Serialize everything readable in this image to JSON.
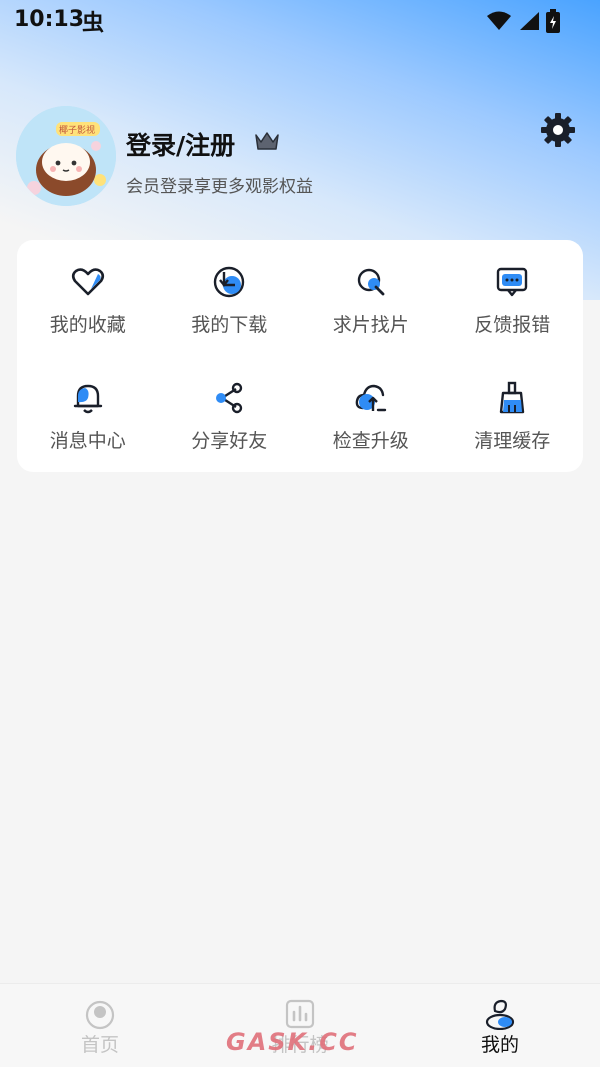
{
  "status_bar": {
    "time": "10:13",
    "bug_glyph": "虫",
    "icons": [
      "wifi-icon",
      "signal-icon",
      "battery-icon"
    ]
  },
  "profile": {
    "title": "登录/注册",
    "subtitle": "会员登录享更多观影权益",
    "avatar_text": "椰子影视",
    "icons": [
      "crown-icon",
      "settings-gear-icon"
    ]
  },
  "menu": {
    "items": [
      {
        "label": "我的收藏",
        "icon": "heart-icon"
      },
      {
        "label": "我的下载",
        "icon": "download-icon"
      },
      {
        "label": "求片找片",
        "icon": "search-film-icon"
      },
      {
        "label": "反馈报错",
        "icon": "feedback-icon"
      },
      {
        "label": "消息中心",
        "icon": "bell-icon"
      },
      {
        "label": "分享好友",
        "icon": "share-icon"
      },
      {
        "label": "检查升级",
        "icon": "cloud-upload-icon"
      },
      {
        "label": "清理缓存",
        "icon": "broom-icon"
      }
    ]
  },
  "bottom_nav": {
    "tabs": [
      {
        "label": "首页",
        "icon": "home-icon",
        "active": false
      },
      {
        "label": "排行榜",
        "icon": "chart-icon",
        "active": false
      },
      {
        "label": "我的",
        "icon": "profile-icon",
        "active": true
      }
    ]
  },
  "watermark": "GASK.CC",
  "colors": {
    "accent": "#2f8cf5",
    "text": "#111111",
    "muted": "#555555",
    "inactive": "#c4c4c4"
  }
}
